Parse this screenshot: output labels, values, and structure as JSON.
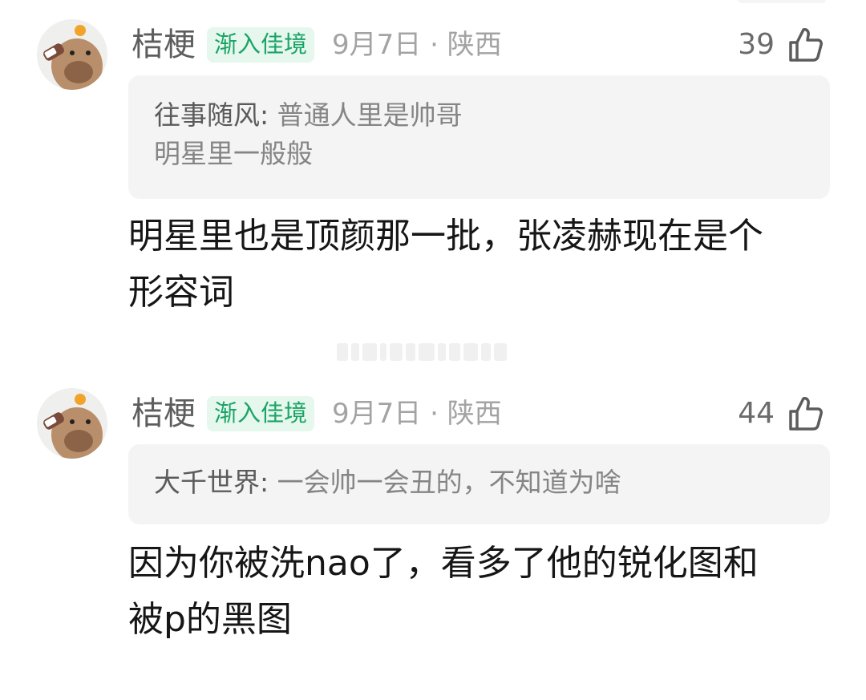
{
  "comments": [
    {
      "username": "桔梗",
      "badge": "渐入佳境",
      "meta": "9月7日 · 陕西",
      "likes": "39",
      "quote": {
        "author": "往事随风:",
        "lines": [
          "普通人里是帅哥",
          "明星里一般般"
        ]
      },
      "body_lines": [
        "明星里也是顶颜那一批，张凌赫现在是个",
        "形容词"
      ]
    },
    {
      "username": "桔梗",
      "badge": "渐入佳境",
      "meta": "9月7日 · 陕西",
      "likes": "44",
      "quote": {
        "author": "大千世界:",
        "lines": [
          "一会帅一会丑的，不知道为啥"
        ]
      },
      "body_lines": [
        "因为你被洗nao了，看多了他的锐化图和",
        "被p的黑图"
      ]
    }
  ],
  "icons": {
    "like": "thumbs-up-icon",
    "avatar": "capybara-avatar"
  },
  "colors": {
    "badge_bg": "#e6f7ee",
    "badge_text": "#1ca466",
    "quote_bg": "#f4f4f4"
  }
}
